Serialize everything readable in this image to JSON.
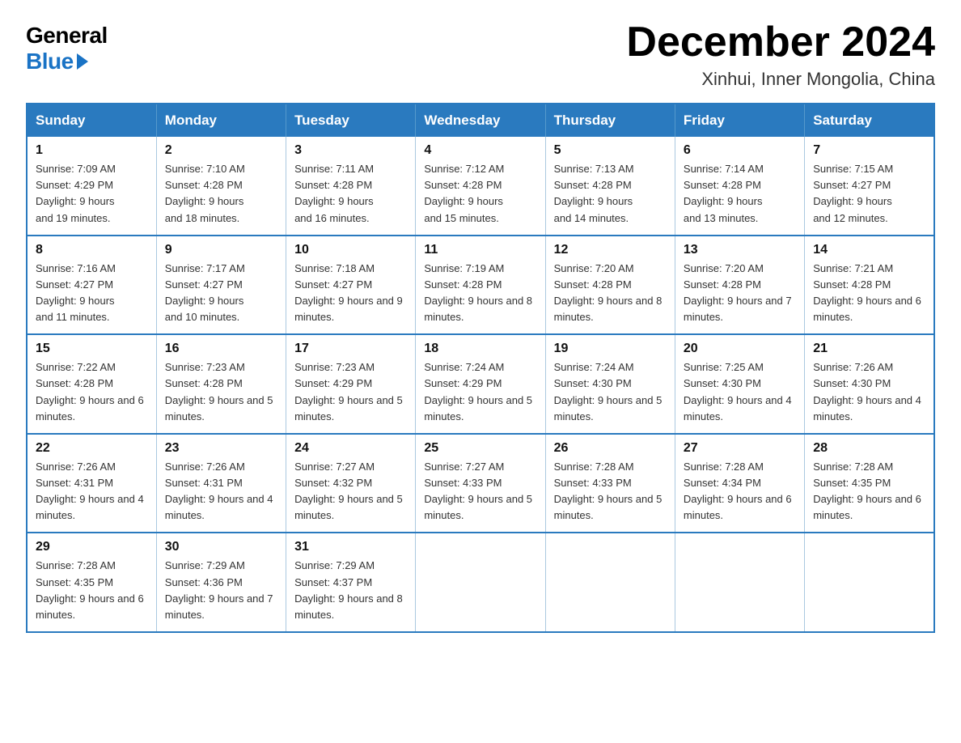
{
  "logo": {
    "general": "General",
    "blue": "Blue"
  },
  "title": {
    "month_year": "December 2024",
    "location": "Xinhui, Inner Mongolia, China"
  },
  "weekdays": [
    "Sunday",
    "Monday",
    "Tuesday",
    "Wednesday",
    "Thursday",
    "Friday",
    "Saturday"
  ],
  "weeks": [
    [
      {
        "day": "1",
        "sunrise": "7:09 AM",
        "sunset": "4:29 PM",
        "daylight": "9 hours and 19 minutes."
      },
      {
        "day": "2",
        "sunrise": "7:10 AM",
        "sunset": "4:28 PM",
        "daylight": "9 hours and 18 minutes."
      },
      {
        "day": "3",
        "sunrise": "7:11 AM",
        "sunset": "4:28 PM",
        "daylight": "9 hours and 16 minutes."
      },
      {
        "day": "4",
        "sunrise": "7:12 AM",
        "sunset": "4:28 PM",
        "daylight": "9 hours and 15 minutes."
      },
      {
        "day": "5",
        "sunrise": "7:13 AM",
        "sunset": "4:28 PM",
        "daylight": "9 hours and 14 minutes."
      },
      {
        "day": "6",
        "sunrise": "7:14 AM",
        "sunset": "4:28 PM",
        "daylight": "9 hours and 13 minutes."
      },
      {
        "day": "7",
        "sunrise": "7:15 AM",
        "sunset": "4:27 PM",
        "daylight": "9 hours and 12 minutes."
      }
    ],
    [
      {
        "day": "8",
        "sunrise": "7:16 AM",
        "sunset": "4:27 PM",
        "daylight": "9 hours and 11 minutes."
      },
      {
        "day": "9",
        "sunrise": "7:17 AM",
        "sunset": "4:27 PM",
        "daylight": "9 hours and 10 minutes."
      },
      {
        "day": "10",
        "sunrise": "7:18 AM",
        "sunset": "4:27 PM",
        "daylight": "9 hours and 9 minutes."
      },
      {
        "day": "11",
        "sunrise": "7:19 AM",
        "sunset": "4:28 PM",
        "daylight": "9 hours and 8 minutes."
      },
      {
        "day": "12",
        "sunrise": "7:20 AM",
        "sunset": "4:28 PM",
        "daylight": "9 hours and 8 minutes."
      },
      {
        "day": "13",
        "sunrise": "7:20 AM",
        "sunset": "4:28 PM",
        "daylight": "9 hours and 7 minutes."
      },
      {
        "day": "14",
        "sunrise": "7:21 AM",
        "sunset": "4:28 PM",
        "daylight": "9 hours and 6 minutes."
      }
    ],
    [
      {
        "day": "15",
        "sunrise": "7:22 AM",
        "sunset": "4:28 PM",
        "daylight": "9 hours and 6 minutes."
      },
      {
        "day": "16",
        "sunrise": "7:23 AM",
        "sunset": "4:28 PM",
        "daylight": "9 hours and 5 minutes."
      },
      {
        "day": "17",
        "sunrise": "7:23 AM",
        "sunset": "4:29 PM",
        "daylight": "9 hours and 5 minutes."
      },
      {
        "day": "18",
        "sunrise": "7:24 AM",
        "sunset": "4:29 PM",
        "daylight": "9 hours and 5 minutes."
      },
      {
        "day": "19",
        "sunrise": "7:24 AM",
        "sunset": "4:30 PM",
        "daylight": "9 hours and 5 minutes."
      },
      {
        "day": "20",
        "sunrise": "7:25 AM",
        "sunset": "4:30 PM",
        "daylight": "9 hours and 4 minutes."
      },
      {
        "day": "21",
        "sunrise": "7:26 AM",
        "sunset": "4:30 PM",
        "daylight": "9 hours and 4 minutes."
      }
    ],
    [
      {
        "day": "22",
        "sunrise": "7:26 AM",
        "sunset": "4:31 PM",
        "daylight": "9 hours and 4 minutes."
      },
      {
        "day": "23",
        "sunrise": "7:26 AM",
        "sunset": "4:31 PM",
        "daylight": "9 hours and 4 minutes."
      },
      {
        "day": "24",
        "sunrise": "7:27 AM",
        "sunset": "4:32 PM",
        "daylight": "9 hours and 5 minutes."
      },
      {
        "day": "25",
        "sunrise": "7:27 AM",
        "sunset": "4:33 PM",
        "daylight": "9 hours and 5 minutes."
      },
      {
        "day": "26",
        "sunrise": "7:28 AM",
        "sunset": "4:33 PM",
        "daylight": "9 hours and 5 minutes."
      },
      {
        "day": "27",
        "sunrise": "7:28 AM",
        "sunset": "4:34 PM",
        "daylight": "9 hours and 6 minutes."
      },
      {
        "day": "28",
        "sunrise": "7:28 AM",
        "sunset": "4:35 PM",
        "daylight": "9 hours and 6 minutes."
      }
    ],
    [
      {
        "day": "29",
        "sunrise": "7:28 AM",
        "sunset": "4:35 PM",
        "daylight": "9 hours and 6 minutes."
      },
      {
        "day": "30",
        "sunrise": "7:29 AM",
        "sunset": "4:36 PM",
        "daylight": "9 hours and 7 minutes."
      },
      {
        "day": "31",
        "sunrise": "7:29 AM",
        "sunset": "4:37 PM",
        "daylight": "9 hours and 8 minutes."
      },
      null,
      null,
      null,
      null
    ]
  ],
  "labels": {
    "sunrise_prefix": "Sunrise: ",
    "sunset_prefix": "Sunset: ",
    "daylight_prefix": "Daylight: "
  }
}
